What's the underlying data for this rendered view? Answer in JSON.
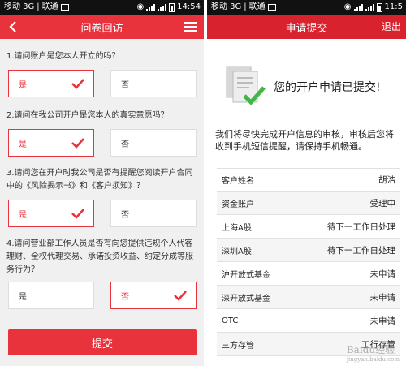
{
  "left": {
    "status": {
      "carrier": "移动 3G",
      "carrier2": "联通",
      "time": "14:54"
    },
    "title": "问卷回访",
    "questions": [
      {
        "text": "1.请问账户是您本人开立的吗？",
        "yes": "是",
        "no": "否",
        "selected": "yes"
      },
      {
        "text": "2.请问在我公司开户是您本人的真实意愿吗？",
        "yes": "是",
        "no": "否",
        "selected": "yes"
      },
      {
        "text": "3.请问您在开户时我公司是否有提醒您阅读开户合同中的《风险揭示书》和《客户须知》？",
        "yes": "是",
        "no": "否",
        "selected": "yes"
      },
      {
        "text": "4.请问营业部工作人员是否有向您提供违规个人代客理财、全权代理交易、承诺投资收益、约定分成等服务行为？",
        "yes": "是",
        "no": "否",
        "selected": "no"
      }
    ],
    "submit": "提交"
  },
  "right": {
    "status": {
      "carrier": "移动 3G",
      "carrier2": "联通",
      "time": "11:5"
    },
    "title": "申请提交",
    "logout": "退出",
    "success_title": "您的开户申请已提交!",
    "notice": "我们将尽快完成开户信息的审核，审核后您将收到手机短信提醒，请保持手机畅通。",
    "rows": [
      {
        "label": "客户姓名",
        "value": "胡浩"
      },
      {
        "label": "资金账户",
        "value": "受理中"
      },
      {
        "label": "上海A股",
        "value": "待下一工作日处理"
      },
      {
        "label": "深圳A股",
        "value": "待下一工作日处理"
      },
      {
        "label": "沪开放式基金",
        "value": "未申请"
      },
      {
        "label": "深开放式基金",
        "value": "未申请"
      },
      {
        "label": "OTC",
        "value": "未申请"
      },
      {
        "label": "三方存管",
        "value": "工行存管"
      }
    ]
  },
  "watermark": {
    "text": "Baidu经验",
    "url": "jingyan.baidu.com"
  },
  "colors": {
    "accent": "#e8323c",
    "success_green": "#44b549"
  }
}
